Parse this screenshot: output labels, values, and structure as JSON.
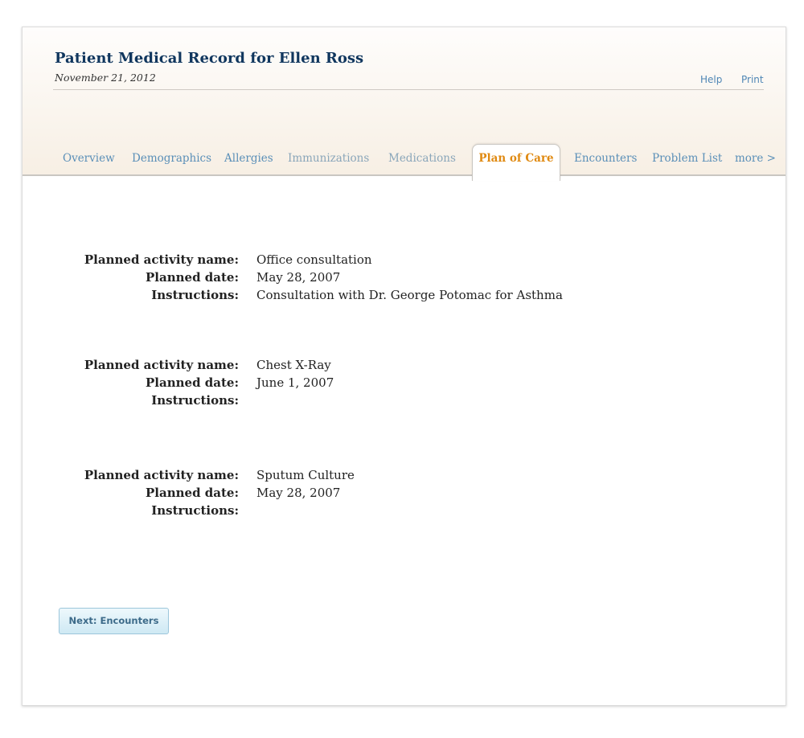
{
  "header": {
    "title": "Patient Medical Record for Ellen Ross",
    "date": "November 21, 2012",
    "links": {
      "help": "Help",
      "print": "Print"
    }
  },
  "tabs": [
    {
      "label": "Overview"
    },
    {
      "label": "Demographics"
    },
    {
      "label": "Allergies"
    },
    {
      "label": "Immunizations"
    },
    {
      "label": "Medications"
    },
    {
      "label": "Plan of Care",
      "active": true
    },
    {
      "label": "Encounters"
    },
    {
      "label": "Problem List"
    },
    {
      "label": "more >"
    }
  ],
  "labels": {
    "activity_name": "Planned activity name:",
    "planned_date": "Planned date:",
    "instructions": "Instructions:"
  },
  "activities": [
    {
      "name": "Office consultation",
      "date": "May 28, 2007",
      "instructions": "Consultation with Dr. George Potomac for Asthma"
    },
    {
      "name": "Chest X-Ray",
      "date": "June 1, 2007",
      "instructions": ""
    },
    {
      "name": "Sputum Culture",
      "date": "May 28, 2007",
      "instructions": ""
    }
  ],
  "next_button": {
    "label": "Next: Encounters"
  },
  "colors": {
    "title": "#10365e",
    "tab_link": "#5a8fb8",
    "tab_active": "#e08a12",
    "util_link": "#4f86b5"
  }
}
